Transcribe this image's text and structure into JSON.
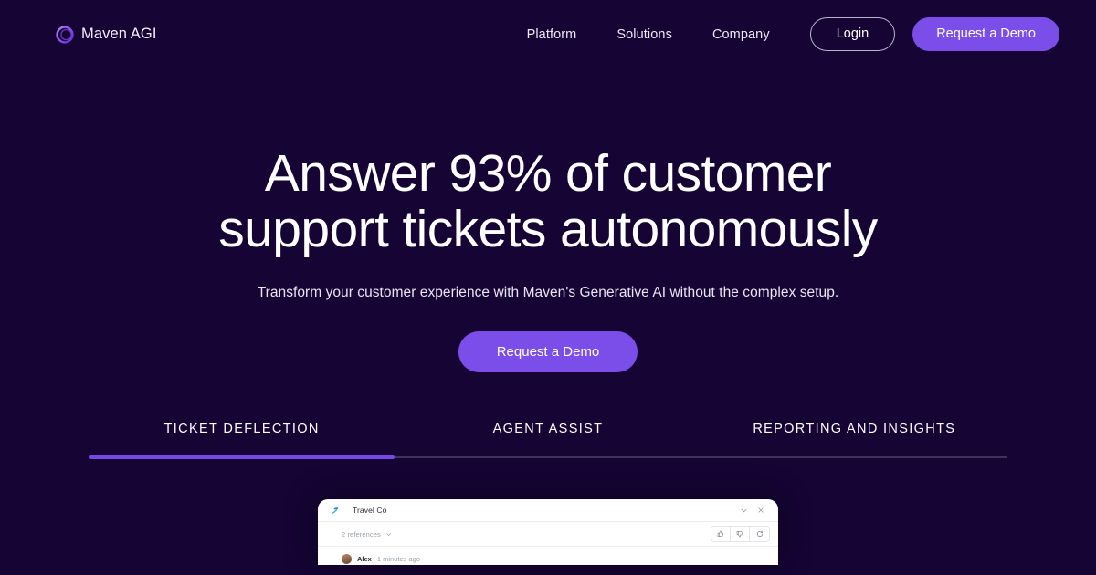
{
  "theme": {
    "background": "#150434",
    "accent": "#7b4eea",
    "tab_indicator": "#7348e4",
    "tab_track": "#3c3358",
    "text": "#ffffff"
  },
  "header": {
    "brand": {
      "name": "Maven AGI",
      "logo_icon": "maven-ring-icon"
    },
    "nav_links": [
      {
        "label": "Platform"
      },
      {
        "label": "Solutions"
      },
      {
        "label": "Company"
      }
    ],
    "login_label": "Login",
    "demo_label": "Request a Demo"
  },
  "hero": {
    "title_line1": "Answer 93% of customer",
    "title_line2": "support tickets autonomously",
    "subtitle": "Transform your customer experience with Maven's Generative AI without the complex setup.",
    "cta_label": "Request a Demo"
  },
  "tabs": {
    "items": [
      {
        "label": "TICKET DEFLECTION",
        "active": true
      },
      {
        "label": "AGENT ASSIST",
        "active": false
      },
      {
        "label": "REPORTING AND INSIGHTS",
        "active": false
      }
    ]
  },
  "chat_widget": {
    "company_name": "Travel Co",
    "company_logo_icon": "travel-co-icon",
    "collapse_icon": "chevron-down-icon",
    "close_icon": "close-icon",
    "references_label": "2 references",
    "references_chevron_icon": "chevron-down-icon",
    "feedback": {
      "thumbs_up_icon": "thumbs-up-icon",
      "thumbs_down_icon": "thumbs-down-icon",
      "regenerate_icon": "refresh-icon"
    },
    "message": {
      "author": "Alex",
      "timestamp": "1 minutes ago"
    }
  }
}
